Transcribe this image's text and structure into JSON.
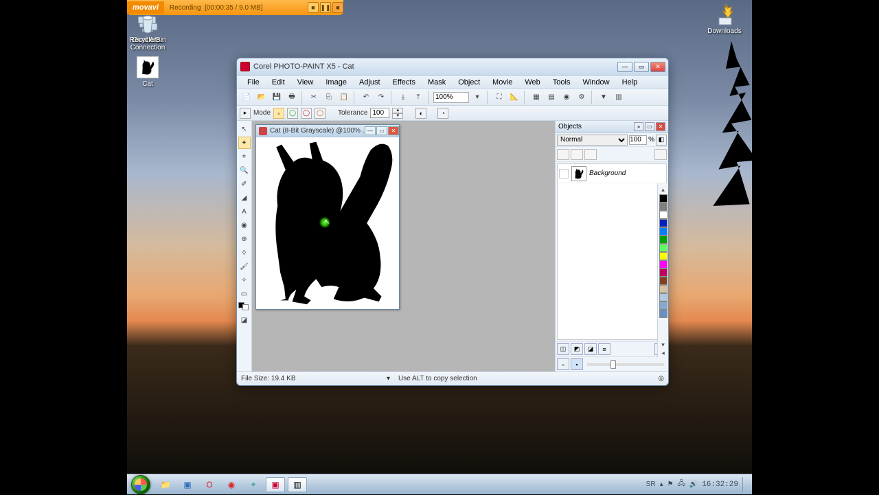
{
  "recording": {
    "brand": "movavi",
    "status": "Recording",
    "time": "[00:00:35 / 9.0 MB]"
  },
  "desktop": {
    "icons": [
      {
        "name": "Computer"
      },
      {
        "name": "Cat"
      }
    ],
    "right_icons": [
      {
        "name": "Downloads"
      }
    ],
    "bottom_icons": [
      {
        "name": "Local Area Connection"
      }
    ],
    "bottom_right_icons": [
      {
        "name": "Recycle Bin"
      }
    ]
  },
  "app": {
    "title": "Corel PHOTO-PAINT X5 - Cat",
    "menu": [
      "File",
      "Edit",
      "View",
      "Image",
      "Adjust",
      "Effects",
      "Mask",
      "Object",
      "Movie",
      "Web",
      "Tools",
      "Window",
      "Help"
    ],
    "zoom": "100%",
    "propbar": {
      "mode": "Mode",
      "tolerance_label": "Tolerance",
      "tolerance": "100"
    },
    "doc_title": "Cat (8-Bit Grayscale) @100% ...",
    "objects": {
      "title": "Objects",
      "blend": "Normal",
      "opacity": "100",
      "items": [
        {
          "name": "Background"
        }
      ]
    },
    "status": {
      "filesize": "File Size: 19.4 KB",
      "hint": "Use ALT to copy selection"
    }
  },
  "taskbar": {
    "lang": "SR",
    "clock": "16:32:29"
  },
  "palette": [
    "#000000",
    "#808080",
    "#ffffff",
    "#0020c0",
    "#0080ff",
    "#00a000",
    "#60ff60",
    "#ffff00",
    "#ff00ff",
    "#c00060",
    "#804020",
    "#d8c0a0",
    "#b0c8e0",
    "#88a8d0",
    "#6890c0"
  ]
}
